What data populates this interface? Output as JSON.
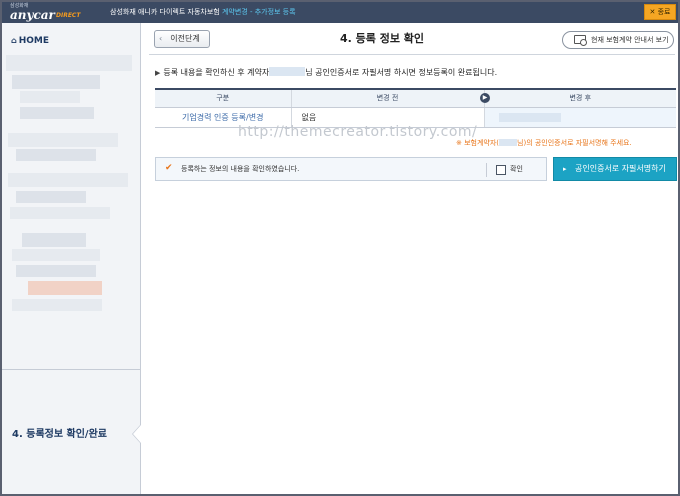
{
  "header": {
    "brand_small": "삼성화재",
    "brand": "anycar",
    "brand_suffix": "DIRECT",
    "service_title": "삼성화재 애니카 다이렉트 자동차보험",
    "service_highlight": "계약변경 - 추가정보 등록",
    "close_label": "✕ 종료"
  },
  "sidebar": {
    "home_label": "HOME",
    "active_step": "4. 등록정보 확인/완료"
  },
  "page": {
    "prev_button": "이전단계",
    "title": "4. 등록 정보 확인",
    "guide_button": "현재 보험계약 안내서 보기",
    "notice_pre": "등록 내용을 확인하신 후 계약자",
    "notice_post": "님 공인인증서로 자필서명 하시면 정보등록이 완료됩니다."
  },
  "table": {
    "headers": [
      "구분",
      "변경 전",
      "변경 후"
    ],
    "rows": [
      {
        "category": "기업경력 인증 등록/변경",
        "before": "없음",
        "after": ""
      }
    ]
  },
  "watermark": "http://themecreator.tistory.com/",
  "orange_note": {
    "pre": "※ 보험계약자(",
    "post": "님)의 공인인증서로 자필서명해 주세요."
  },
  "confirm": {
    "text": "등록하는 정보의 내용을 확인하였습니다.",
    "checkbox_label": "확인"
  },
  "sign_button": "공인인증서로 자필서명하기",
  "colors": {
    "header_bg": "#3b4a63",
    "accent_orange": "#e8751a",
    "button_teal": "#1ca3c4",
    "close_bg": "#f5a623"
  }
}
